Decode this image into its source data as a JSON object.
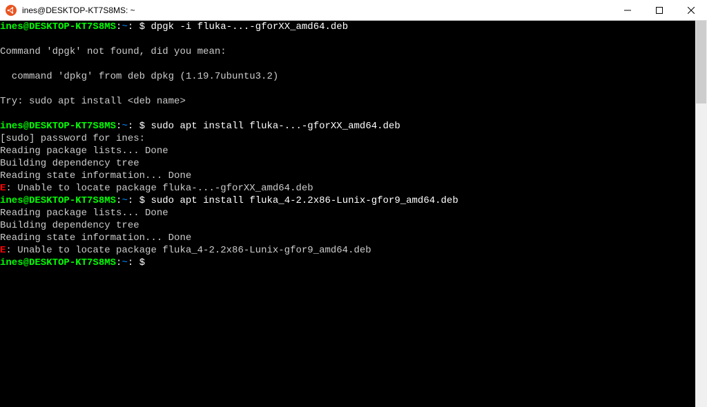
{
  "window": {
    "title": "ines@DESKTOP-KT7S8MS: ~"
  },
  "prompt": {
    "user_host": "ines@DESKTOP-KT7S8MS",
    "separator": ":",
    "path": "~",
    "symbol": "$"
  },
  "lines": [
    {
      "type": "prompt_cmd",
      "command": " dpgk -i fluka-...-gforXX_amd64.deb"
    },
    {
      "type": "blank"
    },
    {
      "type": "output",
      "text": "Command 'dpgk' not found, did you mean:"
    },
    {
      "type": "blank"
    },
    {
      "type": "output",
      "text": "  command 'dpkg' from deb dpkg (1.19.7ubuntu3.2)"
    },
    {
      "type": "blank"
    },
    {
      "type": "output",
      "text": "Try: sudo apt install <deb name>"
    },
    {
      "type": "blank"
    },
    {
      "type": "prompt_cmd",
      "command": " sudo apt install fluka-...-gforXX_amd64.deb"
    },
    {
      "type": "output",
      "text": "[sudo] password for ines:"
    },
    {
      "type": "output",
      "text": "Reading package lists... Done"
    },
    {
      "type": "output",
      "text": "Building dependency tree"
    },
    {
      "type": "output",
      "text": "Reading state information... Done"
    },
    {
      "type": "error",
      "text": ": Unable to locate package fluka-...-gforXX_amd64.deb"
    },
    {
      "type": "prompt_cmd",
      "command": " sudo apt install fluka_4-2.2x86-Lunix-gfor9_amd64.deb"
    },
    {
      "type": "output",
      "text": "Reading package lists... Done"
    },
    {
      "type": "output",
      "text": "Building dependency tree"
    },
    {
      "type": "output",
      "text": "Reading state information... Done"
    },
    {
      "type": "error",
      "text": ": Unable to locate package fluka_4-2.2x86-Lunix-gfor9_amd64.deb"
    },
    {
      "type": "prompt_cmd",
      "command": ""
    }
  ],
  "error_prefix": "E"
}
